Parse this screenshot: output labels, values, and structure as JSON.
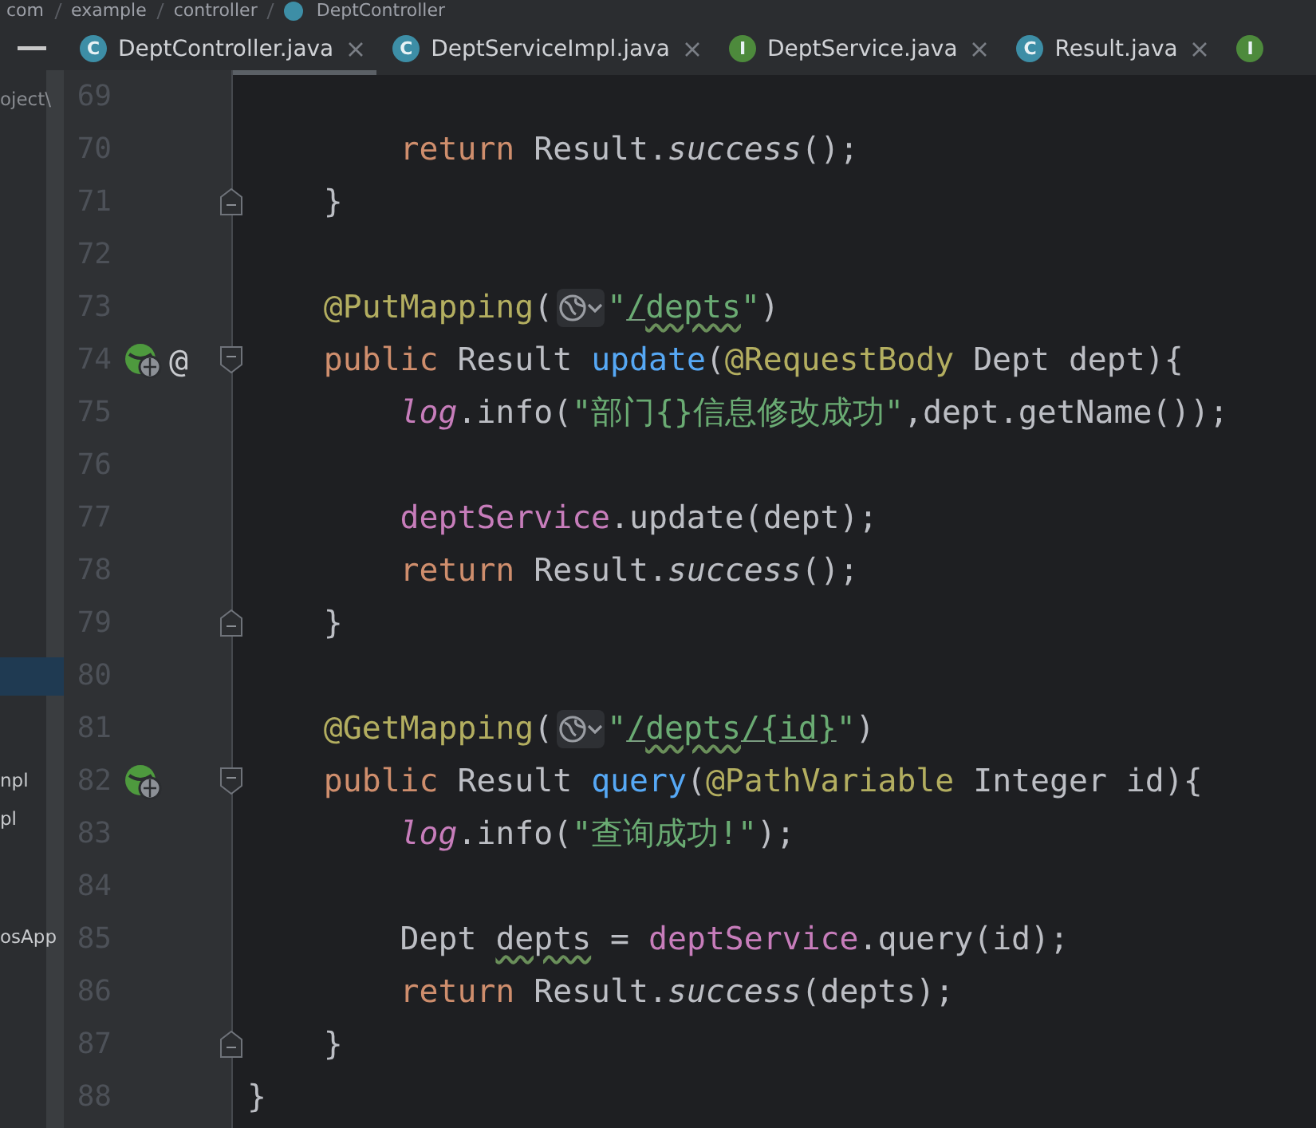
{
  "breadcrumb": [
    "com",
    "example",
    "controller",
    "DeptController"
  ],
  "tabs": [
    {
      "label": "DeptController.java",
      "kind": "class",
      "badge": "C",
      "selected": true
    },
    {
      "label": "DeptServiceImpl.java",
      "kind": "class",
      "badge": "C",
      "selected": false
    },
    {
      "label": "DeptService.java",
      "kind": "interface",
      "badge": "I",
      "selected": false
    },
    {
      "label": "Result.java",
      "kind": "class",
      "badge": "C",
      "selected": false
    },
    {
      "kind": "interface",
      "badge": "I",
      "selected": false
    }
  ],
  "sidebar": {
    "items": [
      {
        "text": "oject\\",
        "selected": false
      },
      {
        "selected": true
      },
      {
        "text": "npl",
        "selected": false
      },
      {
        "text": "pl",
        "selected": false
      },
      {
        "text": "osApp",
        "selected": false
      }
    ]
  },
  "editor": {
    "lines": [
      {
        "number": "69"
      },
      {
        "number": "70",
        "kind": "body",
        "tokens": [
          {
            "kind": "keyword",
            "text": "return"
          },
          {
            "kind": "plain",
            "text": " Result."
          },
          {
            "kind": "static",
            "text": "success"
          },
          {
            "kind": "plain",
            "text": "();"
          }
        ]
      },
      {
        "number": "71",
        "kind": "member",
        "gutter": [
          {
            "kind": "fold-end"
          }
        ],
        "tokens": [
          {
            "kind": "plain",
            "text": "}"
          }
        ]
      },
      {
        "number": "72"
      },
      {
        "number": "73",
        "kind": "member",
        "tokens": [
          {
            "kind": "annotation",
            "text": "@PutMapping"
          },
          {
            "kind": "plain",
            "text": "("
          },
          {
            "kind": "url-chip"
          },
          {
            "kind": "string",
            "text": "\""
          },
          {
            "kind": "string-link",
            "text": "/"
          },
          {
            "kind": "string-typo",
            "text": "depts"
          },
          {
            "kind": "string",
            "text": "\""
          },
          {
            "kind": "plain",
            "text": ")"
          }
        ]
      },
      {
        "number": "74",
        "kind": "member",
        "gutter": [
          {
            "kind": "bean"
          },
          {
            "kind": "text",
            "text": "@"
          },
          {
            "kind": "fold-start"
          }
        ],
        "tokens": [
          {
            "kind": "keyword",
            "text": "public"
          },
          {
            "kind": "plain",
            "text": " Result "
          },
          {
            "kind": "method",
            "text": "update"
          },
          {
            "kind": "plain",
            "text": "("
          },
          {
            "kind": "annotation",
            "text": "@RequestBody"
          },
          {
            "kind": "plain",
            "text": " Dept dept){"
          }
        ]
      },
      {
        "number": "75",
        "kind": "body",
        "tokens": [
          {
            "kind": "field-static",
            "text": "log"
          },
          {
            "kind": "plain",
            "text": ".info("
          },
          {
            "kind": "string",
            "text": "\"部门{}信息修改成功\""
          },
          {
            "kind": "plain",
            "text": ",dept.getName());"
          }
        ]
      },
      {
        "number": "76"
      },
      {
        "number": "77",
        "kind": "body",
        "tokens": [
          {
            "kind": "field",
            "text": "deptService"
          },
          {
            "kind": "plain",
            "text": ".update(dept);"
          }
        ]
      },
      {
        "number": "78",
        "kind": "body",
        "tokens": [
          {
            "kind": "keyword",
            "text": "return"
          },
          {
            "kind": "plain",
            "text": " Result."
          },
          {
            "kind": "static",
            "text": "success"
          },
          {
            "kind": "plain",
            "text": "();"
          }
        ]
      },
      {
        "number": "79",
        "kind": "member",
        "gutter": [
          {
            "kind": "fold-end"
          }
        ],
        "tokens": [
          {
            "kind": "plain",
            "text": "}"
          }
        ]
      },
      {
        "number": "80"
      },
      {
        "number": "81",
        "kind": "member",
        "tokens": [
          {
            "kind": "annotation",
            "text": "@GetMapping"
          },
          {
            "kind": "plain",
            "text": "("
          },
          {
            "kind": "url-chip"
          },
          {
            "kind": "string",
            "text": "\""
          },
          {
            "kind": "string-link",
            "text": "/"
          },
          {
            "kind": "string-typo",
            "text": "depts"
          },
          {
            "kind": "string-link",
            "text": "/{id}"
          },
          {
            "kind": "string",
            "text": "\""
          },
          {
            "kind": "plain",
            "text": ")"
          }
        ]
      },
      {
        "number": "82",
        "kind": "member",
        "gutter": [
          {
            "kind": "bean"
          },
          {
            "kind": "fold-start"
          }
        ],
        "tokens": [
          {
            "kind": "keyword",
            "text": "public"
          },
          {
            "kind": "plain",
            "text": " Result "
          },
          {
            "kind": "method",
            "text": "query"
          },
          {
            "kind": "plain",
            "text": "("
          },
          {
            "kind": "annotation",
            "text": "@PathVariable"
          },
          {
            "kind": "plain",
            "text": " Integer id){"
          }
        ]
      },
      {
        "number": "83",
        "kind": "body",
        "tokens": [
          {
            "kind": "field-static",
            "text": "log"
          },
          {
            "kind": "plain",
            "text": ".info("
          },
          {
            "kind": "string",
            "text": "\"查询成功!\""
          },
          {
            "kind": "plain",
            "text": ");"
          }
        ]
      },
      {
        "number": "84"
      },
      {
        "number": "85",
        "kind": "body",
        "tokens": [
          {
            "kind": "plain",
            "text": "Dept "
          },
          {
            "kind": "plain-typo",
            "text": "depts"
          },
          {
            "kind": "plain",
            "text": " = "
          },
          {
            "kind": "field",
            "text": "deptService"
          },
          {
            "kind": "plain",
            "text": ".query(id);"
          }
        ]
      },
      {
        "number": "86",
        "kind": "body",
        "tokens": [
          {
            "kind": "keyword",
            "text": "return"
          },
          {
            "kind": "plain",
            "text": " Result."
          },
          {
            "kind": "static",
            "text": "success"
          },
          {
            "kind": "plain",
            "text": "(depts);"
          }
        ]
      },
      {
        "number": "87",
        "kind": "member",
        "gutter": [
          {
            "kind": "fold-end"
          }
        ],
        "tokens": [
          {
            "kind": "plain",
            "text": "}"
          }
        ]
      },
      {
        "number": "88",
        "kind": "top",
        "tokens": [
          {
            "kind": "plain",
            "text": "}"
          }
        ]
      }
    ]
  }
}
